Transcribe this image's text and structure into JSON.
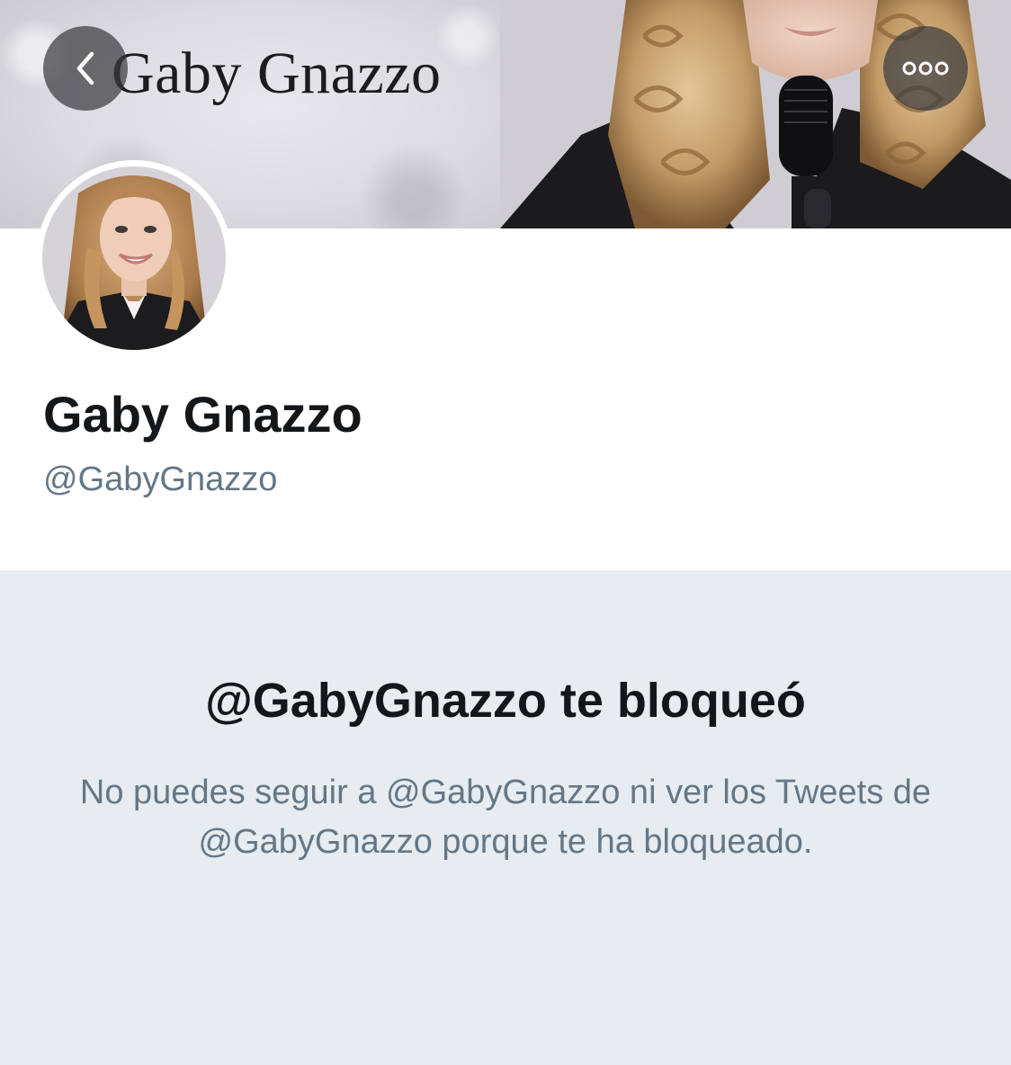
{
  "header": {
    "banner_text": "Gaby Gnazzo",
    "back_icon": "chevron-left-icon",
    "more_icon": "more-options-icon"
  },
  "profile": {
    "display_name": "Gaby Gnazzo",
    "handle": "@GabyGnazzo"
  },
  "blocked": {
    "title": "@GabyGnazzo te bloqueó",
    "message": "No puedes seguir a @GabyGnazzo ni ver los Tweets de @GabyGnazzo porque te ha bloqueado."
  },
  "colors": {
    "panel_background": "#e6ecf0",
    "primary_text": "#14171a",
    "secondary_text": "#657786"
  }
}
